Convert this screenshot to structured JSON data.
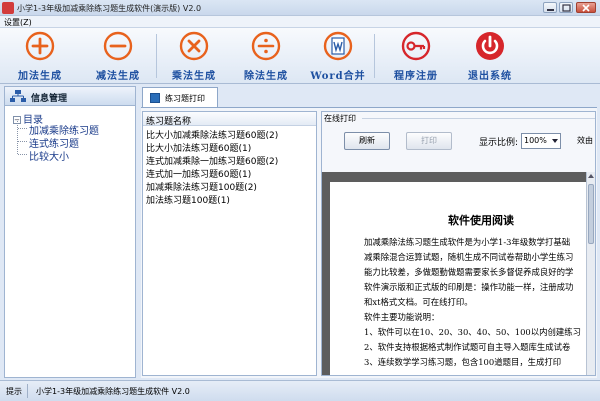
{
  "window": {
    "title": "小学1-3年级加减乘除练习题生成软件(演示版) V2.0"
  },
  "menu": {
    "settings": "设置(Z)"
  },
  "toolbar": {
    "items": [
      {
        "label": "加法生成",
        "icon": "plus-icon"
      },
      {
        "label": "减法生成",
        "icon": "minus-icon"
      },
      {
        "label": "乘法生成",
        "icon": "times-icon"
      },
      {
        "label": "除法生成",
        "icon": "divide-icon"
      },
      {
        "label": "Word合并",
        "icon": "word-document-icon"
      },
      {
        "label": "程序注册",
        "icon": "key-icon"
      },
      {
        "label": "退出系统",
        "icon": "power-icon"
      }
    ],
    "accent_color": "#e8621d",
    "exit_color": "#d6262b"
  },
  "left_panel": {
    "header": "信息管理",
    "tree": {
      "root": "目录",
      "items": [
        "加减乘除练习题",
        "连式练习题",
        "比较大小"
      ]
    }
  },
  "tab": {
    "label": "练习题打印"
  },
  "exercise_list": {
    "header": "练习题名称",
    "items": [
      "比大小加减乘除法练习题60题(2)",
      "比大小加法练习题60题(1)",
      "连式加减乘除一加练习题60题(2)",
      "连式加一加练习题60题(1)",
      "加减乘除法练习题100题(2)",
      "加法练习题100题(1)"
    ]
  },
  "print_panel": {
    "group_label": "在线打印",
    "refresh_label": "刷新",
    "print_label": "打印",
    "scale_label": "显示比例:",
    "scale_value": "100%",
    "truncated_label": "效由",
    "document": {
      "title": "软件使用阅读",
      "lines": [
        "加减乘除法练习题生成软件是为小学1-3年级数学打基础",
        "减乘除混合运算试题，随机生成不同试卷帮助小学生练习",
        "能力比较差，多做题勤做题需要家长多督促养成良好的学",
        "软件演示版和正式版的印刷是：操作功能一样，注册成功",
        "和xt格式文档。可在线打印。",
        "软件主要功能说明：",
        "1、软件可以在10、20、30、40、50、100以内创建练习",
        "2、软件支持根据格式制作试题可自主导入题库生成试卷",
        "3、连续数学学习练习题，包含100道题目，生成打印"
      ]
    }
  },
  "status_bar": {
    "label": "提示",
    "text": "小学1-3年级加减乘除练习题生成软件 V2.0"
  }
}
